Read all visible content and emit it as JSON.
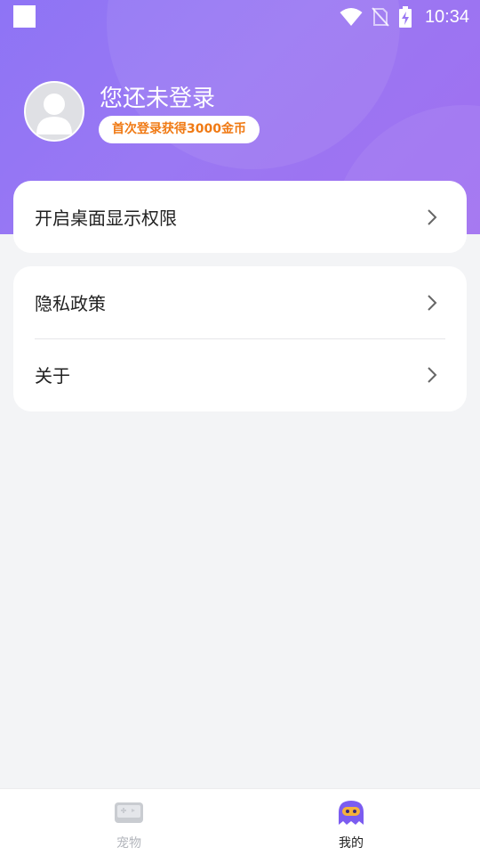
{
  "status_bar": {
    "time": "10:34"
  },
  "profile": {
    "title": "您还未登录",
    "badge": "首次登录获得3000金币"
  },
  "menu": {
    "card1": [
      {
        "label": "开启桌面显示权限"
      }
    ],
    "card2": [
      {
        "label": "隐私政策"
      },
      {
        "label": "关于"
      }
    ]
  },
  "bottom_nav": {
    "items": [
      {
        "label": "宠物",
        "icon": "gamepad-icon",
        "active": false
      },
      {
        "label": "我的",
        "icon": "ghost-icon",
        "active": true
      }
    ]
  },
  "colors": {
    "header_gradient_start": "#8e74f5",
    "header_gradient_end": "#a06ff0",
    "badge_text": "#f07a14",
    "background": "#f3f4f6",
    "active_icon": "#7b5cf0",
    "inactive_icon": "#c9ccd1"
  }
}
